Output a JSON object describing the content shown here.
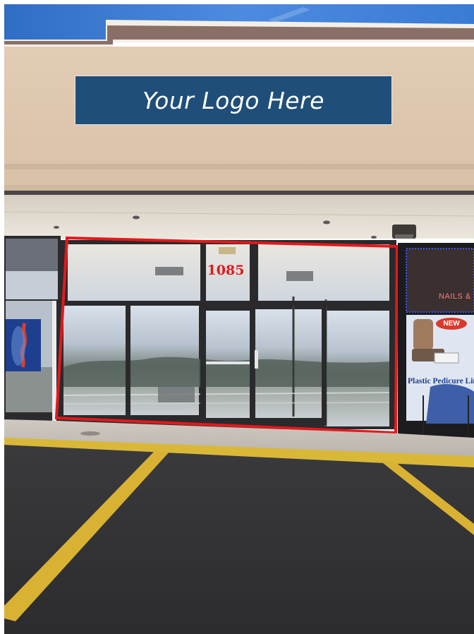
{
  "logo_placeholder": {
    "text": "Your Logo Here",
    "background_color": "#1f4e79",
    "text_color": "#ffffff"
  },
  "storefront": {
    "unit_number": "1085",
    "highlight_color": "#e3191c"
  },
  "neighbor_store": {
    "window_sign": "NAILS &",
    "poster_badge": "NEW",
    "poster_caption": "Plastic Pedicure Liners"
  },
  "icons": [
    "security-light-icon",
    "spine-poster-icon",
    "pedicure-chair-icon",
    "parking-stripe-icon"
  ]
}
